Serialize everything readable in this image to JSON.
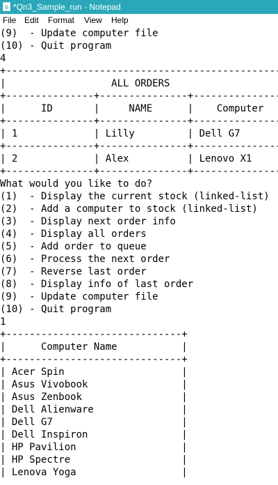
{
  "window": {
    "title": "*Qn3_Sample_run - Notepad",
    "titlebar_color": "#2aa7b8"
  },
  "menu": [
    "File",
    "Edit",
    "Format",
    "View",
    "Help"
  ],
  "editor": {
    "lines": [
      "(9)  - Update computer file",
      "(10) - Quit program",
      "4",
      "+-----------------------------------------------+",
      "|                  ALL ORDERS                   |",
      "+---------------+---------------+---------------+",
      "|      ID       |     NAME      |    Computer   |",
      "+---------------+---------------+---------------+",
      "| 1             | Lilly         | Dell G7       |",
      "+---------------+---------------+---------------+",
      "| 2             | Alex          | Lenovo X1     |",
      "+---------------+---------------+---------------+",
      "What would you like to do?",
      "(1)  - Display the current stock (linked-list)",
      "(2)  - Add a computer to stock (linked-list)",
      "(3)  - Display next order info",
      "(4)  - Display all orders",
      "(5)  - Add order to queue",
      "(6)  - Process the next order",
      "(7)  - Reverse last order",
      "(8)  - Display info of last order",
      "(9)  - Update computer file",
      "(10) - Quit program",
      "1",
      "+------------------------------+",
      "|      Computer Name           |",
      "+------------------------------+",
      "| Acer Spin                    |",
      "| Asus Vivobook                |",
      "| Asus Zenbook                 |",
      "| Dell Alienware               |",
      "| Dell G7                      |",
      "| Dell Inspiron                |",
      "| HP Pavilion                  |",
      "| HP Spectre                   |",
      "| Lenova Yoga                  |"
    ]
  }
}
